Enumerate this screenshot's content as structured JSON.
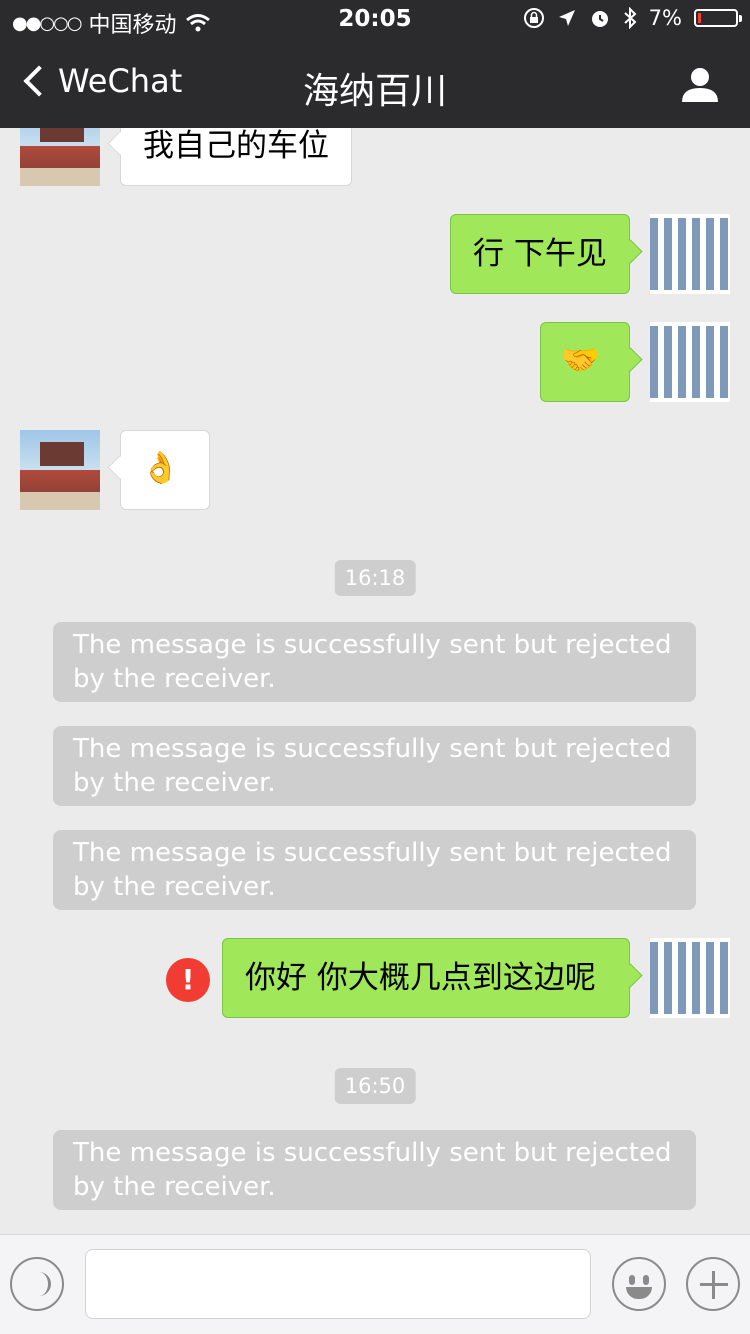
{
  "status_bar": {
    "signal_dots": "●●○○○",
    "carrier": "中国移动",
    "time": "20:05",
    "battery": "7%",
    "battery_color": "#ff3b30"
  },
  "nav": {
    "back_label": "WeChat",
    "title": "海纳百川",
    "icons": [
      "chevron-left-icon",
      "user-profile-icon"
    ]
  },
  "messages": {
    "m1_text": "我自己的车位",
    "m2_text": "行 下午见",
    "m3_emoji": "🤝",
    "m4_emoji": "👌",
    "m5_text": "你好 你大概几点到这边呢",
    "error_mark": "!"
  },
  "times": {
    "t1": "16:18",
    "t2": "16:50"
  },
  "notices": {
    "text": "The message is successfully sent but rejected by the receiver."
  },
  "input_bar": {
    "icons": [
      "voice-icon",
      "emoji-icon",
      "plus-icon"
    ]
  },
  "colors": {
    "sent_bubble": "#a0e75a",
    "received_bubble": "#ffffff",
    "chat_background": "#ebebeb",
    "header_background": "#2b2b2e",
    "error": "#f03c33"
  }
}
